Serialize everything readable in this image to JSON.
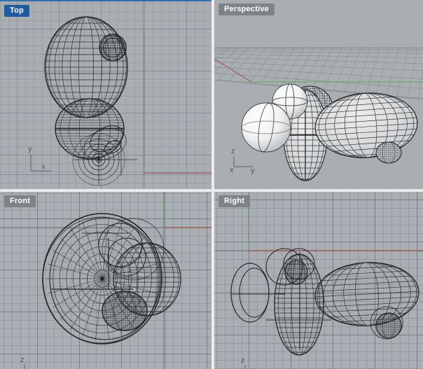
{
  "viewports": [
    {
      "id": "top",
      "label": "Top",
      "active": true,
      "axes": [
        "y",
        "x"
      ]
    },
    {
      "id": "perspective",
      "label": "Perspective",
      "active": false,
      "axes": [
        "z",
        "x",
        "y"
      ]
    },
    {
      "id": "front",
      "label": "Front",
      "active": false,
      "axes": [
        "z"
      ]
    },
    {
      "id": "right",
      "label": "Right",
      "active": false,
      "axes": [
        "z"
      ]
    }
  ],
  "colors": {
    "viewport_bg": "#a9aeb2",
    "divider": "#ececec",
    "active_border": "#2f6fae",
    "label_active_bg": "#1d5c9e",
    "label_bg": "rgba(122,127,131,0.92)",
    "label_text": "#ffffff",
    "grid_minor": "rgba(127,133,139,0.50)",
    "grid_major": "rgba(94,100,106,0.50)",
    "grid_faint_minor": "rgba(127,133,139,0.30)",
    "grid_faint_major": "rgba(94,100,106,0.30)",
    "axis_red": "#a85c5c",
    "axis_green": "#73a36f",
    "wireframe": "#212426",
    "axis_icon": "#53585c",
    "persp_grid": "rgba(100,106,112,0.60)",
    "sphere_highlight": "#ffffff",
    "sphere_shadow": "#b2b6b8",
    "surface_light": "#ededee",
    "surface_mid": "#c3c7c9"
  }
}
